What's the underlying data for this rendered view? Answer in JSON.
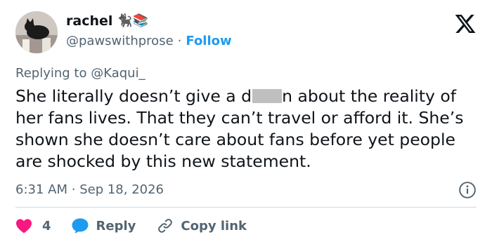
{
  "author": {
    "display_name": "rachel",
    "name_emojis": "🐈‍⬛📚",
    "handle": "@pawswithprose",
    "separator": "·",
    "follow_label": "Follow"
  },
  "reply_context": {
    "prefix": "Replying to",
    "mention": "@Kaqui_"
  },
  "tweet": {
    "text_before_redaction": "She literally doesn’t give a d",
    "text_after_redaction": "n about the reality of her fans lives. That they can’t travel or afford it. She’s shown she doesn’t care about fans before yet people are shocked by this new statement."
  },
  "meta": {
    "time": "6:31 AM",
    "separator": "·",
    "date": "Sep 18, 2026"
  },
  "actions": {
    "like_count": "4",
    "reply_label": "Reply",
    "copy_link_label": "Copy link"
  },
  "colors": {
    "brand_blue": "#1d9bf0",
    "like_pink": "#f91880",
    "muted_text": "#536471",
    "main_text": "#0f1419",
    "divider": "#cfd9de"
  }
}
